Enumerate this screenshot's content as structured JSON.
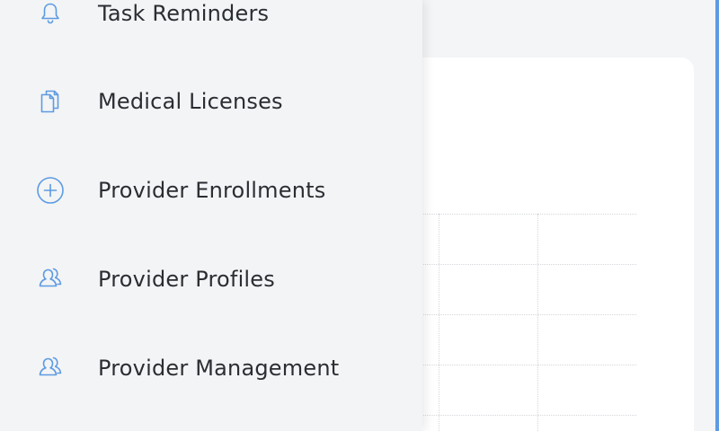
{
  "colors": {
    "accent": "#5d9be3",
    "icon": "#5d9be3",
    "drawer_bg": "#f3f4f5",
    "text": "#2a2e33",
    "page_bg": "#f3f5f7",
    "card_bg": "#ffffff"
  },
  "drawer": {
    "items": [
      {
        "label": "Task Reminders",
        "icon": "bell-icon"
      },
      {
        "label": "Medical Licenses",
        "icon": "document-icon"
      },
      {
        "label": "Provider Enrollments",
        "icon": "plus-circle-icon"
      },
      {
        "label": "Provider Profiles",
        "icon": "users-icon"
      },
      {
        "label": "Provider Management",
        "icon": "users-icon"
      }
    ]
  }
}
